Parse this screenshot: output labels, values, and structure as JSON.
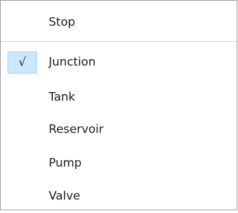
{
  "menu": {
    "items": [
      {
        "label": "Stop",
        "checked": false
      },
      {
        "label": "Junction",
        "checked": true
      },
      {
        "label": "Tank",
        "checked": false
      },
      {
        "label": "Reservoir",
        "checked": false
      },
      {
        "label": "Pump",
        "checked": false
      },
      {
        "label": "Valve",
        "checked": false
      }
    ],
    "check_glyph": "√",
    "colors": {
      "background": "#ffffff",
      "border": "#9a9a9a",
      "separator": "#d2d2d2",
      "check_highlight": "#cce8ff",
      "check_highlight_border": "#99d1ff",
      "text": "#1b1b1b"
    }
  }
}
